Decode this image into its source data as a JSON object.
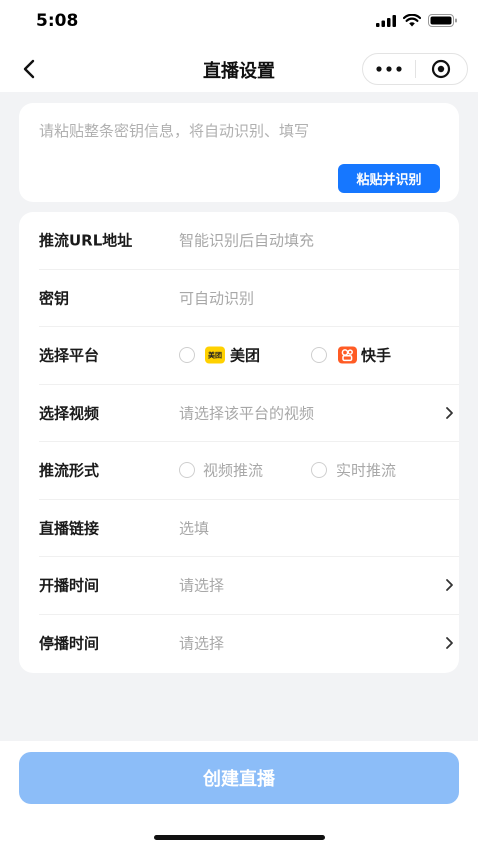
{
  "status_bar": {
    "time": "5:08"
  },
  "nav": {
    "title": "直播设置"
  },
  "paste": {
    "hint": "请粘贴整条密钥信息，将自动识别、填写",
    "button_label": "粘贴并识别"
  },
  "form": {
    "stream_url": {
      "label": "推流URL地址",
      "placeholder": "智能识别后自动填充"
    },
    "secret_key": {
      "label": "密钥",
      "placeholder": "可自动识别"
    },
    "platform": {
      "label": "选择平台",
      "options": [
        {
          "name": "美团",
          "logo_text": "美团",
          "logo_color": "#FFD100"
        },
        {
          "name": "快手",
          "logo_color": "#FF5B24"
        }
      ]
    },
    "video": {
      "label": "选择视频",
      "placeholder": "请选择该平台的视频"
    },
    "push_mode": {
      "label": "推流形式",
      "options": [
        "视频推流",
        "实时推流"
      ]
    },
    "live_link": {
      "label": "直播链接",
      "placeholder": "选填"
    },
    "start_time": {
      "label": "开播时间",
      "placeholder": "请选择"
    },
    "end_time": {
      "label": "停播时间",
      "placeholder": "请选择"
    }
  },
  "footer": {
    "create_button": "创建直播"
  },
  "colors": {
    "accent": "#1677FF",
    "create_button_disabled": "#8CBDF8",
    "background": "#F2F3F5",
    "placeholder_text": "#A8A8A8"
  }
}
